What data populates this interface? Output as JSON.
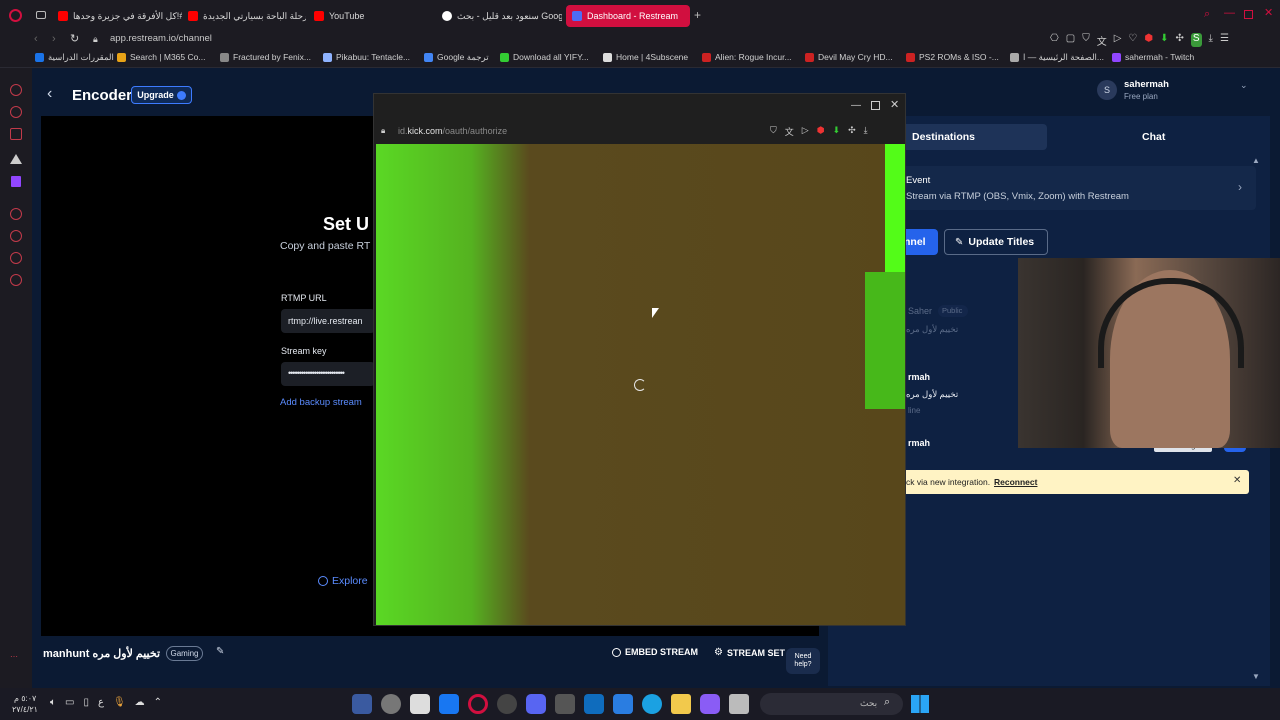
{
  "browser": {
    "tabs": [
      {
        "label": "كل الأفرقة في جزيرة وحدها!#",
        "color": "#ff0000"
      },
      {
        "label": "رحلة الباحة بسيارتي الجديدة",
        "color": "#ff0000"
      },
      {
        "label": "YouTube",
        "color": "#ff0000"
      },
      {
        "label": "سنعود بعد قليل - بحث Google",
        "color": "#ffffff"
      },
      {
        "label": "Dashboard - Restream",
        "color": "#4f6cf5"
      }
    ],
    "new_tab": "+",
    "address": "app.restream.io/channel",
    "bookmarks": [
      {
        "label": "المقررات الدراسية",
        "color": "#1a73e8"
      },
      {
        "label": "Search | M365 Co...",
        "color": "#e8a317"
      },
      {
        "label": "Fractured by Fenix...",
        "color": "#888888"
      },
      {
        "label": "Pikabuu: Tentacle...",
        "color": "#8fb3ff"
      },
      {
        "label": "Google ترجمة",
        "color": "#4285f4"
      },
      {
        "label": "Download all YIFY...",
        "color": "#33cc33"
      },
      {
        "label": "Home | 4Subscene",
        "color": "#dddddd"
      },
      {
        "label": "Alien: Rogue Incur...",
        "color": "#cc2222"
      },
      {
        "label": "Devil May Cry HD...",
        "color": "#cc2222"
      },
      {
        "label": "PS2 ROMs & ISO -...",
        "color": "#cc2222"
      },
      {
        "label": "الصفحة الرئيسية — ا...",
        "color": "#aaaaaa"
      },
      {
        "label": "sahermah - Twitch",
        "color": "#9146ff"
      }
    ]
  },
  "header": {
    "title": "Encoder",
    "upgrade": "Upgrade"
  },
  "user": {
    "initial": "S",
    "name": "sahermah",
    "plan": "Free plan"
  },
  "setup": {
    "title": "Set U",
    "subtitle": "Copy and paste RT",
    "rtmp_label": "RTMP URL",
    "rtmp_value": "rtmp://live.restrean",
    "key_label": "Stream key",
    "key_value": "••••••••••••••••••••••••••",
    "backup": "Add backup stream",
    "explore": "Explore"
  },
  "stream": {
    "title": "manhunt تخييم لأول مره",
    "category": "Gaming",
    "embed": "EMBED STREAM",
    "settings": "STREAM SET",
    "help": "Need help?"
  },
  "right": {
    "tab_destinations": "Destinations",
    "tab_chat": "Chat",
    "event_title": "Event",
    "event_sub": "Stream via RTMP (OBS, Vmix, Zoom) with Restream",
    "channel_btn": "nnel",
    "update_titles": "Update Titles",
    "dest1_name": "Saher",
    "dest1_badge": "Public",
    "dest1_sub": "تخييم لأول مره",
    "dest2_name": "rmah",
    "dest2_sub": "تخييم لأول مره",
    "dest2_status": "line",
    "dest3_name": "rmah",
    "settings": "Settings",
    "notice": "ck via new integration.",
    "reconnect": "Reconnect"
  },
  "popup": {
    "url_prefix": "id.",
    "url_host": "kick.com",
    "url_path": "/oauth/authorize"
  },
  "taskbar": {
    "clock_time": "٥:٠٧ م",
    "clock_date": "٢٧/٤/٢١",
    "lang": "ع",
    "search_placeholder": "بحث"
  },
  "colors": {
    "accent": "#2563eb",
    "tab_active": "#d10f3f",
    "app_bg": "#0b1a33",
    "kick_green": "#53fc18"
  }
}
